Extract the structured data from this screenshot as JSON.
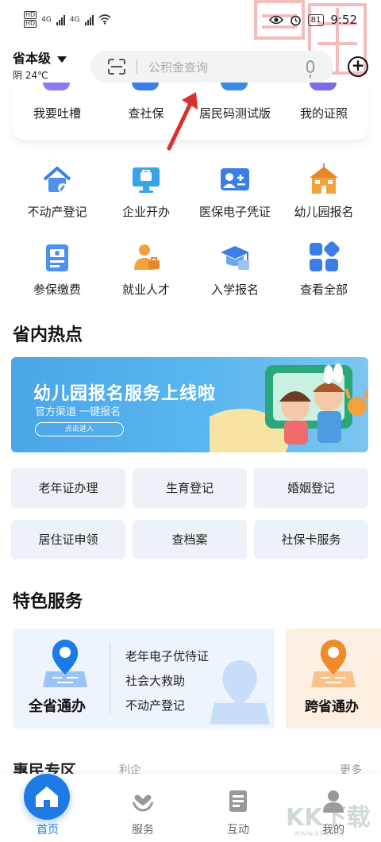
{
  "status_bar": {
    "network_1": "4G",
    "network_2": "4G",
    "hd_1": "HD",
    "hd_2": "HD",
    "battery": "81",
    "time": "9:52"
  },
  "header": {
    "location": "省本级",
    "weather": "阴 24℃",
    "search_placeholder": "公积金查询"
  },
  "top_card": {
    "items": [
      {
        "label": "我要吐槽"
      },
      {
        "label": "查社保"
      },
      {
        "label": "居民码测试版"
      },
      {
        "label": "我的证照"
      }
    ]
  },
  "services": {
    "items": [
      {
        "label": "不动产登记",
        "icon": "house-icon"
      },
      {
        "label": "企业开办",
        "icon": "monitor-icon"
      },
      {
        "label": "医保电子凭证",
        "icon": "id-card-icon"
      },
      {
        "label": "幼儿园报名",
        "icon": "school-icon"
      },
      {
        "label": "参保缴费",
        "icon": "clipboard-icon"
      },
      {
        "label": "就业人才",
        "icon": "worker-icon"
      },
      {
        "label": "入学报名",
        "icon": "graduation-cap-icon"
      },
      {
        "label": "查看全部",
        "icon": "grid-icon"
      }
    ]
  },
  "hot": {
    "title": "省内热点",
    "banner": {
      "title": "幼儿园报名服务上线啦",
      "subtitle": "官方渠道 一键报名",
      "button": "点击进入"
    },
    "buttons": [
      {
        "label": "老年证办理"
      },
      {
        "label": "生育登记"
      },
      {
        "label": "婚姻登记"
      },
      {
        "label": "居住证申领"
      },
      {
        "label": "查档案"
      },
      {
        "label": "社保卡服务"
      }
    ]
  },
  "special": {
    "title": "特色服务",
    "card1": {
      "name": "全省通办",
      "subs": [
        "老年电子优待证",
        "社会大救助",
        "不动产登记"
      ]
    },
    "card2": {
      "name": "跨省通办"
    },
    "chevron": "《"
  },
  "peek": {
    "title": "惠民专区",
    "sub": "利企",
    "more": "更多"
  },
  "tabbar": {
    "tabs": [
      {
        "label": "首页"
      },
      {
        "label": "服务"
      },
      {
        "label": "互动"
      },
      {
        "label": "我的"
      }
    ]
  },
  "watermark": {
    "text": "KK下载",
    "url": "www.kkx.net"
  },
  "colors": {
    "primary": "#1e7be6",
    "hot_button_bg": "#edf2f9",
    "special_card_bg": "#eef4fc",
    "special_card2_bg": "#fdefe2",
    "banner_blue": "#4aa6e8",
    "arrow_red": "#d8312e"
  }
}
